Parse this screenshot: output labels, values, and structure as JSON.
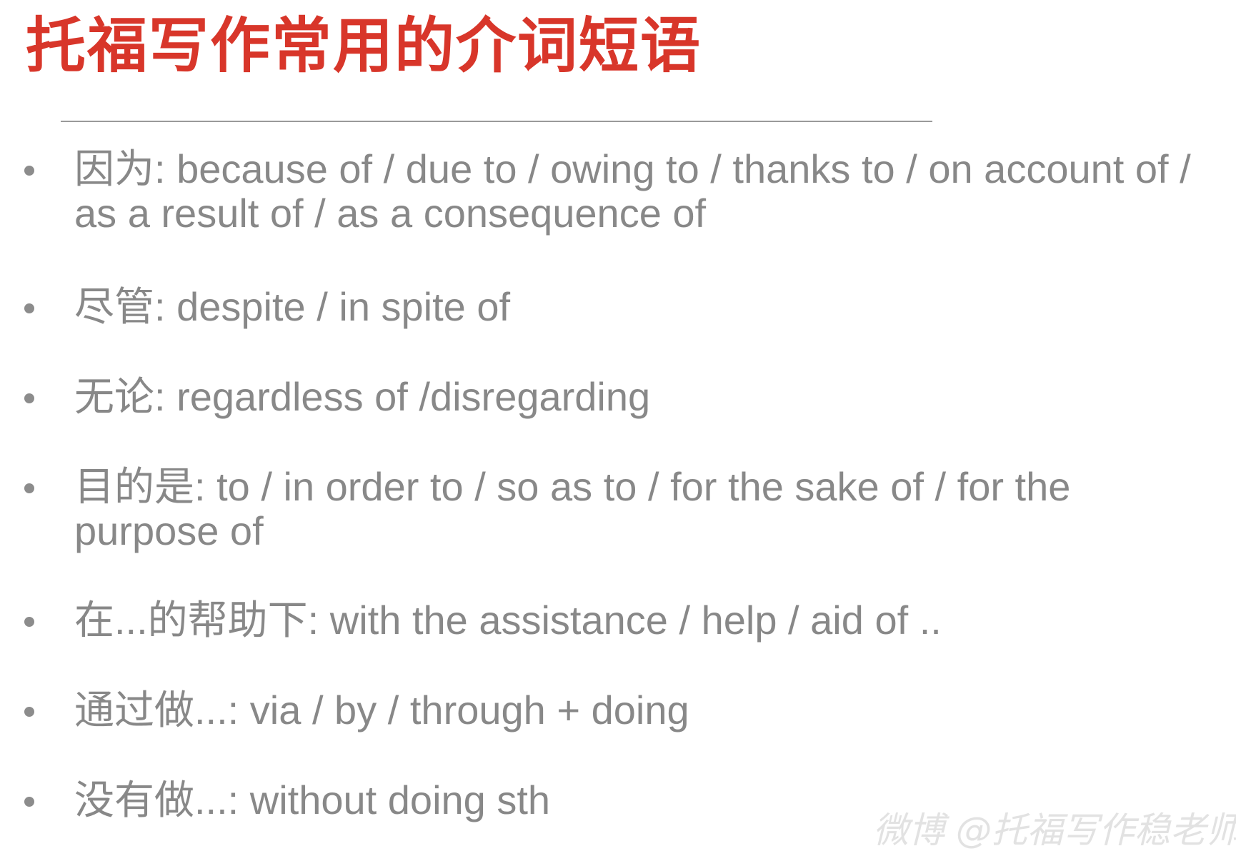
{
  "slide": {
    "title": "托福写作常用的介词短语",
    "watermark": "微博 @托福写作稳老师",
    "colors": {
      "title": "#d8362a",
      "text": "#888888",
      "rule": "#9a9a9a"
    },
    "items": [
      {
        "text": "因为: because of / due to / owing to / thanks to  / on account of / as a result of / as a consequence of"
      },
      {
        "text": "尽管: despite / in spite of"
      },
      {
        "text": "无论: regardless of /disregarding"
      },
      {
        "text": "目的是: to / in order to / so as to / for the sake of /  for the purpose of"
      },
      {
        "text": "在...的帮助下: with the assistance / help / aid of .."
      },
      {
        "text": "通过做...: via / by / through + doing"
      },
      {
        "text": "没有做...: without doing sth"
      }
    ]
  }
}
